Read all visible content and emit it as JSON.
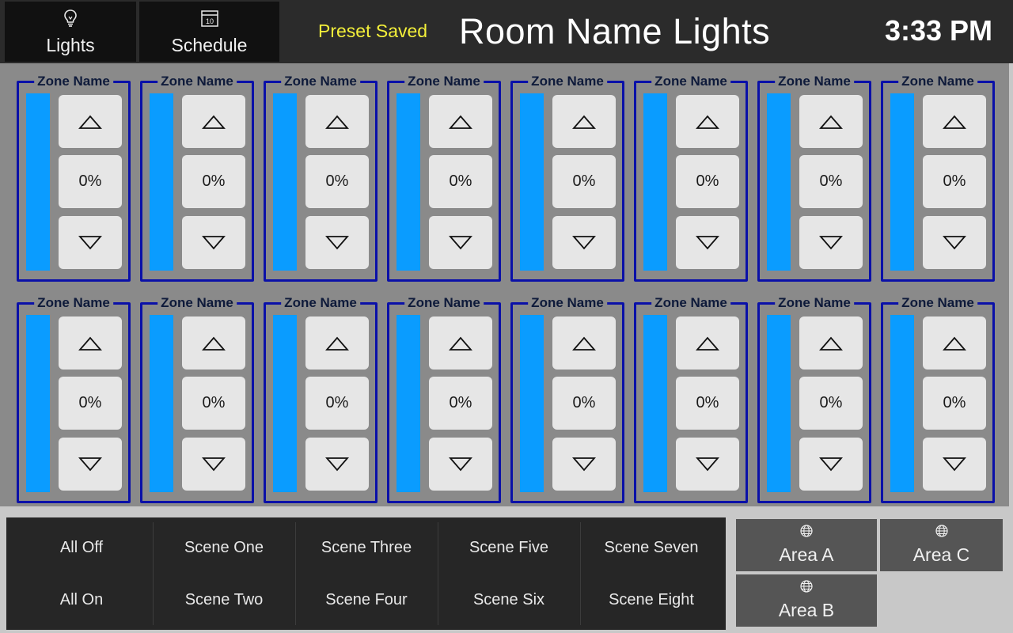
{
  "header": {
    "nav": [
      {
        "label": "Lights",
        "icon": "lightbulb-icon"
      },
      {
        "label": "Schedule",
        "icon": "calendar-icon",
        "icon_text": "10"
      }
    ],
    "status": "Preset Saved",
    "title": "Room Name Lights",
    "clock": "3:33 PM"
  },
  "zones": {
    "up_icon": "triangle-up-icon",
    "down_icon": "triangle-down-icon",
    "bar_color": "#0a9cff",
    "border_color": "#0a10a8",
    "rows": [
      [
        {
          "name": "Zone Name",
          "level": "0%"
        },
        {
          "name": "Zone Name",
          "level": "0%"
        },
        {
          "name": "Zone Name",
          "level": "0%"
        },
        {
          "name": "Zone Name",
          "level": "0%"
        },
        {
          "name": "Zone Name",
          "level": "0%"
        },
        {
          "name": "Zone Name",
          "level": "0%"
        },
        {
          "name": "Zone Name",
          "level": "0%"
        },
        {
          "name": "Zone Name",
          "level": "0%"
        }
      ],
      [
        {
          "name": "Zone Name",
          "level": "0%"
        },
        {
          "name": "Zone Name",
          "level": "0%"
        },
        {
          "name": "Zone Name",
          "level": "0%"
        },
        {
          "name": "Zone Name",
          "level": "0%"
        },
        {
          "name": "Zone Name",
          "level": "0%"
        },
        {
          "name": "Zone Name",
          "level": "0%"
        },
        {
          "name": "Zone Name",
          "level": "0%"
        },
        {
          "name": "Zone Name",
          "level": "0%"
        }
      ]
    ]
  },
  "scenes": {
    "top_row": [
      "All Off",
      "Scene One",
      "Scene Three",
      "Scene Five",
      "Scene Seven"
    ],
    "bottom_row": [
      "All On",
      "Scene Two",
      "Scene Four",
      "Scene Six",
      "Scene Eight"
    ]
  },
  "areas": [
    {
      "label": "Area A",
      "icon": "globe-icon"
    },
    {
      "label": "Area C",
      "icon": "globe-icon"
    },
    {
      "label": "Area B",
      "icon": "globe-icon"
    }
  ],
  "colors": {
    "header_bg": "#2b2b2b",
    "status_text": "#f4f03a",
    "zones_bg": "#8a8a8a",
    "button_bg": "#e6e6e6"
  }
}
